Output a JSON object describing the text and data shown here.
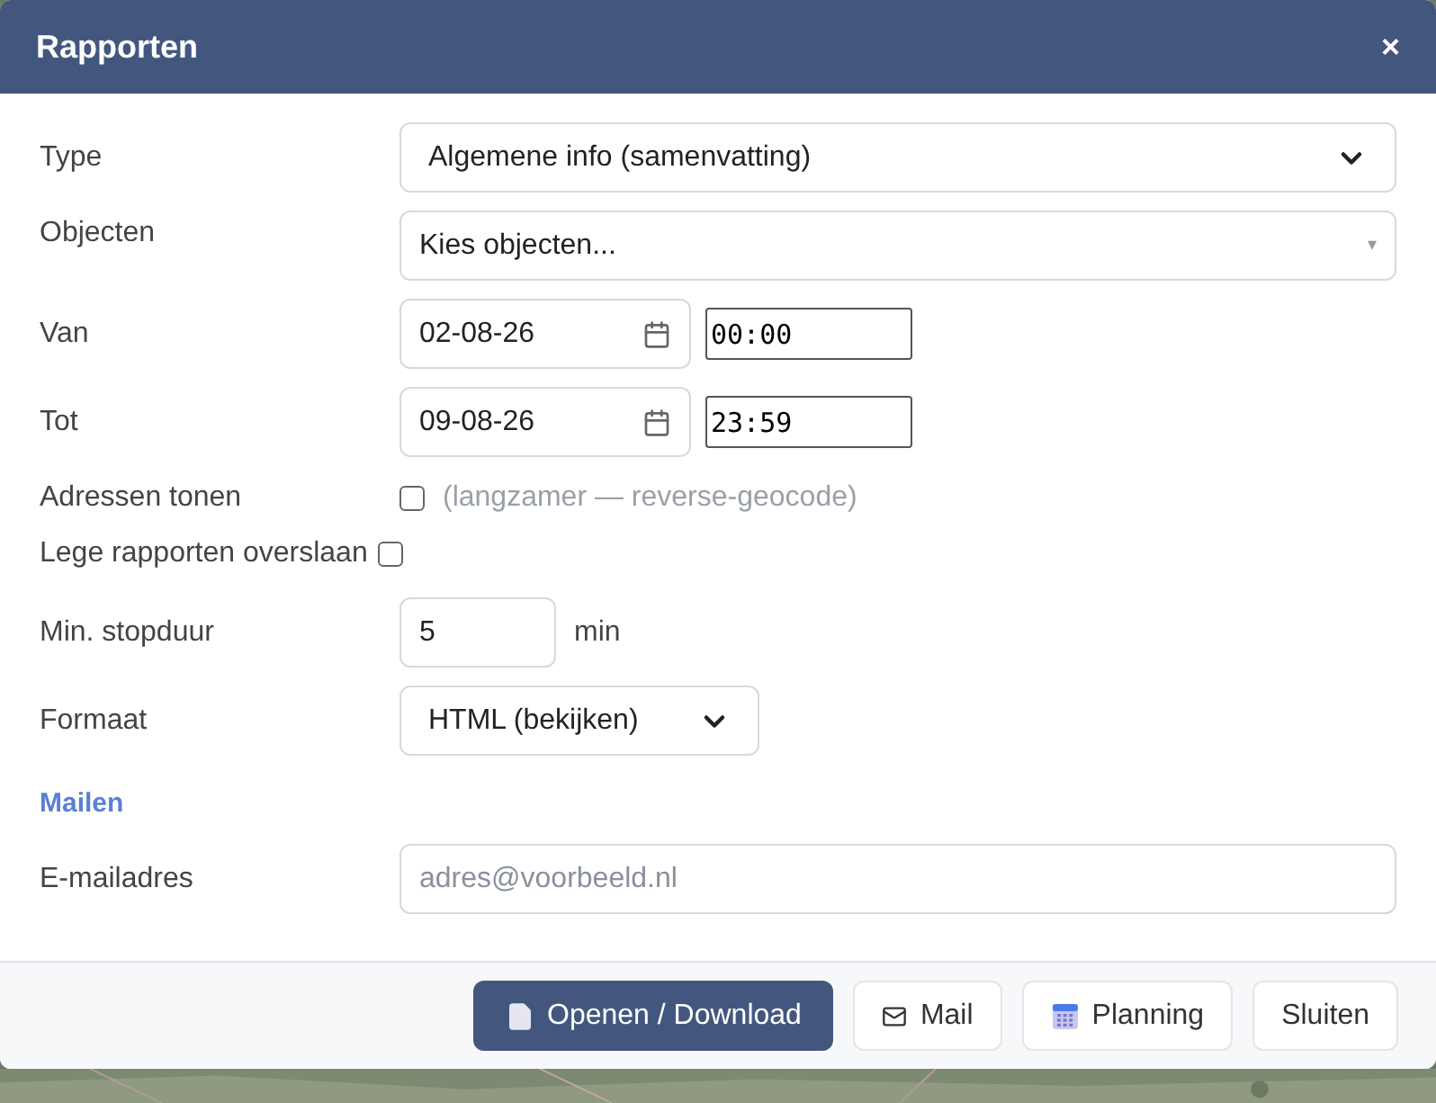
{
  "dialog": {
    "title": "Rapporten",
    "close": "×"
  },
  "fields": [
    {
      "kind": "select",
      "label": "Type",
      "value": "Algemene info (samenvatting)"
    },
    {
      "kind": "multiselect",
      "label": "Objecten",
      "placeholder": "Kies objecten...",
      "caret": "▾"
    },
    {
      "kind": "datetime",
      "label": "Van",
      "date": "02-08-26",
      "time": "00:00"
    },
    {
      "kind": "datetime",
      "label": "Tot",
      "date": "09-08-26",
      "time": "23:59"
    },
    {
      "kind": "checkbox",
      "label": "Adressen tonen",
      "checked": false,
      "hint": "(langzamer — reverse-geocode)"
    },
    {
      "kind": "checkbox",
      "label": "Lege rapporten overslaan",
      "checked": false
    },
    {
      "kind": "number",
      "label": "Min. stopduur",
      "value": "5",
      "unit": "min"
    },
    {
      "kind": "compact-select",
      "label": "Formaat",
      "value": "HTML (bekijken)"
    },
    {
      "kind": "heading",
      "label": "Mailen"
    },
    {
      "kind": "text",
      "label": "E-mailadres",
      "placeholder": "adres@voorbeeld.nl"
    }
  ],
  "buttons": [
    {
      "kind": "primary",
      "label": "Openen / Download"
    },
    {
      "kind": "mail",
      "label": "Mail"
    },
    {
      "kind": "calendar",
      "label": "Planning"
    },
    {
      "kind": "plain",
      "label": "Sluiten"
    }
  ]
}
